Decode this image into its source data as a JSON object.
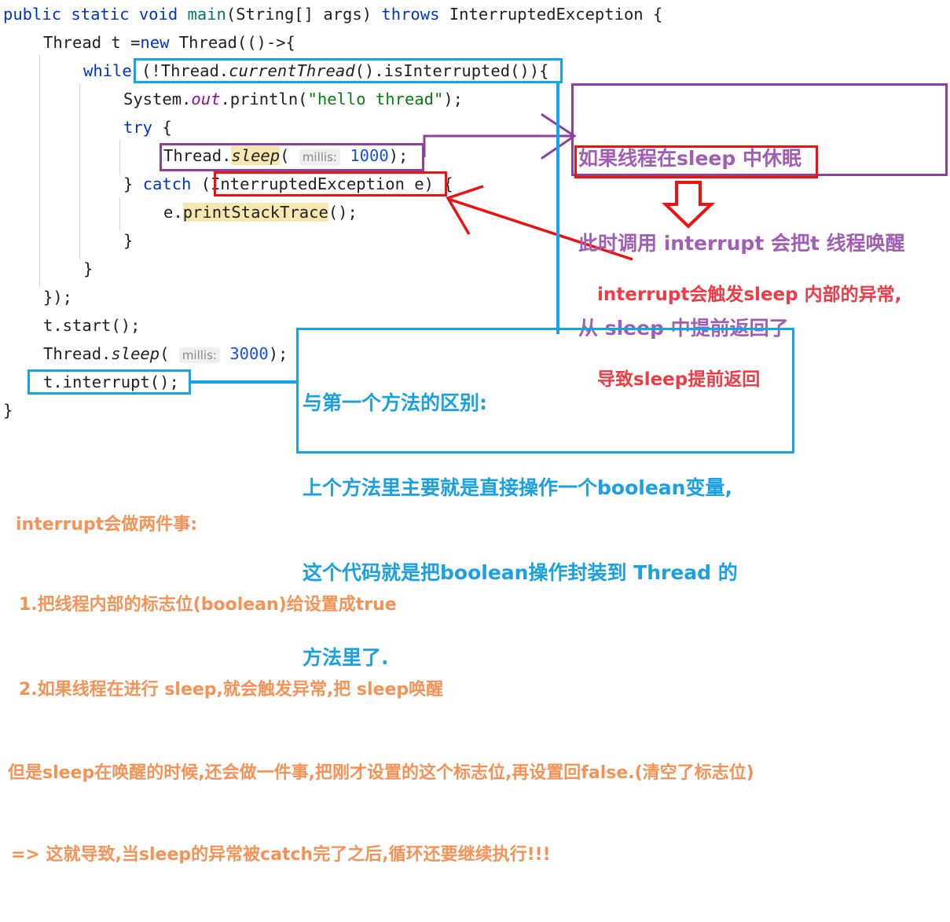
{
  "code": {
    "lines": [
      "public static void main(String[] args) throws InterruptedException {",
      "    Thread t =new Thread(()->{",
      "        while (!Thread.currentThread().isInterrupted()){",
      "            System.out.println(\"hello thread\");",
      "            try {",
      "                Thread.sleep( millis: 1000);",
      "            } catch (InterruptedException e) {",
      "                e.printStackTrace();",
      "            }",
      "        }",
      "    });",
      "    t.start();",
      "    Thread.sleep( millis: 3000);",
      "    t.interrupt();",
      "}"
    ],
    "tokens": {
      "public": "public",
      "static": "static",
      "void": "void",
      "main": "main",
      "string_args": "(String[] args)",
      "throws": "throws",
      "interrupted_exception": "InterruptedException {",
      "thread_t": "Thread t =",
      "new": "new",
      "thread_lambda": " Thread(()->{",
      "while": "while",
      "while_cond": " (!Thread.",
      "current_thread": "currentThread",
      "is_interrupted": "().isInterrupted()){",
      "system": "System.",
      "out": "out",
      "println": ".println(",
      "hello_thread": "\"hello thread\"",
      "println_end": ");",
      "try": "try",
      "try_brace": " {",
      "thread_dot": "Thread.",
      "sleep": "sleep",
      "paren_open": "( ",
      "millis_label": "millis:",
      "millis_1000": "1000",
      "paren_close": ");",
      "close_catch": "} ",
      "catch": "catch",
      "catch_paren": " (InterruptedException e) {",
      "e_dot": "e.",
      "print_stack_trace": "printStackTrace",
      "pst_end": "();",
      "brace": "}",
      "lambda_close": "});",
      "t_start": "t.start();",
      "millis_3000": "3000",
      "t_interrupt": "t.interrupt();",
      "final_brace": "}"
    }
  },
  "highlights": {
    "while_condition_box": "(!Thread.currentThread().isInterrupted())",
    "sleep_box": "Thread.sleep( millis: 1000);",
    "catch_box": "InterruptedException e)",
    "interrupt_box": "t.interrupt();"
  },
  "annotations": {
    "purple_note": {
      "color": "#a05fb5",
      "border": "#8e3fa0",
      "lines": [
        "如果线程在sleep 中休眠",
        "此时调用 interrupt 会把t 线程唤醒",
        "从 sleep 中提前返回了"
      ],
      "emphasis_line_index": 2,
      "emphasis_border": "#ee1111"
    },
    "red_note": {
      "color": "#ef3b46",
      "lines": [
        "interrupt会触发sleep 内部的异常,",
        "导致sleep提前返回"
      ]
    },
    "blue_note": {
      "color": "#1ba1e2",
      "border": "#13a5e8",
      "lines": [
        "与第一个方法的区别:",
        "上个方法里主要就是直接操作一个boolean变量,",
        "这个代码就是把boolean操作封装到 Thread 的",
        "方法里了."
      ]
    },
    "orange_note": {
      "color": "#f79256",
      "lines": [
        "interrupt会做两件事:",
        "1.把线程内部的标志位(boolean)给设置成true",
        "2.如果线程在进行 sleep,就会触发异常,把 sleep唤醒",
        "但是sleep在唤醒的时候,还会做一件事,把刚才设置的这个标志位,再设置回false.(清空了标志位)",
        "=> 这就导致,当sleep的异常被catch完了之后,循环还要继续执行!!!"
      ]
    }
  },
  "connectors": {
    "purple_arrow": "sleep-box-to-purple-note",
    "red_arrow": "red-note-to-catch-box",
    "red_down_arrow": "points-down-to-red-note",
    "blue_line_vertical": "while-box-to-blue-note",
    "blue_line_horizontal": "interrupt-box-to-blue-note"
  },
  "colors": {
    "blue_accent": "#13a5e8",
    "red_accent": "#ee1111",
    "purple_accent": "#8e3fa0",
    "orange_accent": "#f79256",
    "keyword": "#0033b3",
    "string": "#067d17",
    "number": "#1750eb",
    "field": "#871094",
    "method": "#00796b",
    "highlight_bg": "#f7e7b0"
  }
}
